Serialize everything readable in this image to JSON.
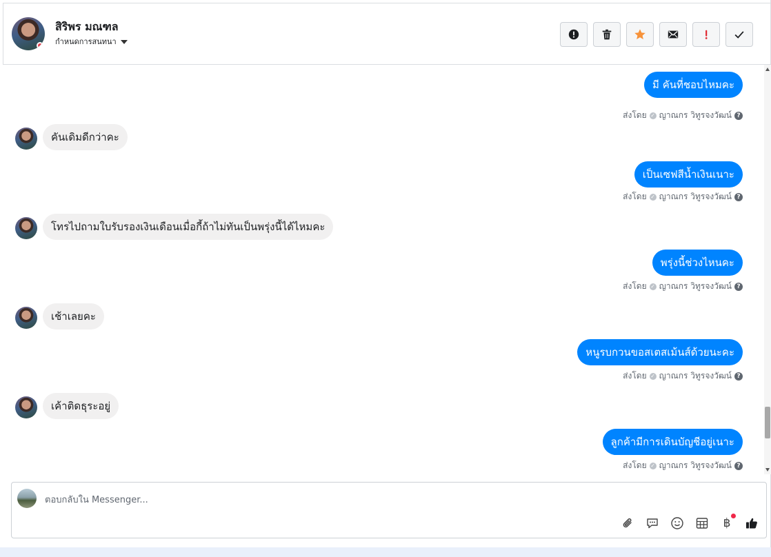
{
  "header": {
    "contact_name": "สิริพร มณฑล",
    "assign_label": "กำหนดการสนทนา"
  },
  "actions": [
    {
      "name": "report-button",
      "icon": "alert-circle-icon"
    },
    {
      "name": "delete-button",
      "icon": "trash-icon"
    },
    {
      "name": "star-button",
      "icon": "star-icon"
    },
    {
      "name": "mark-unread-button",
      "icon": "envelope-icon"
    },
    {
      "name": "important-button",
      "icon": "exclamation-icon"
    },
    {
      "name": "done-button",
      "icon": "check-icon"
    }
  ],
  "messages": [
    {
      "dir": "out",
      "text": "มี คันที่ชอบไหมคะ"
    },
    {
      "dir": "in",
      "text": "คันเดิมดีกว่าคะ"
    },
    {
      "dir": "out",
      "text": "เป็นเซฟสีน้ำเงินเนาะ"
    },
    {
      "dir": "in",
      "text": "โทรไปถามใบรับรองเงินเดือนเมื่อกี้ถ้าไม่ทันเป็นพรุ่งนี้ได้ไหมคะ"
    },
    {
      "dir": "out",
      "text": "พรุ่งนี้ช่วงไหนคะ"
    },
    {
      "dir": "in",
      "text": "เช้าเลยคะ"
    },
    {
      "dir": "out",
      "text": "หนูรบกวนขอสเตสเม้นส์ด้วยนะคะ"
    },
    {
      "dir": "in",
      "text": "เค้าติดธุระอยู่"
    },
    {
      "dir": "out",
      "text": "ลูกค้ามีการเดินบัญชีอยู่เนาะ"
    }
  ],
  "sent_by": {
    "prefix": "ส่งโดย",
    "agent": "ญาณกร วิทูรจงวัฒน์",
    "help": "?"
  },
  "composer": {
    "placeholder": "ตอบกลับใน Messenger..."
  },
  "colors": {
    "outgoing_bubble": "#0084ff",
    "incoming_bubble": "#f1f0f0",
    "star": "#f7923a",
    "important": "#e0262e"
  }
}
